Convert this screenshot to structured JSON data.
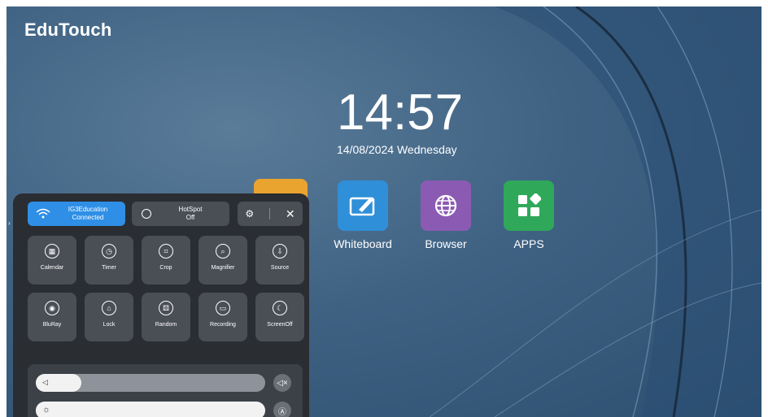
{
  "brand": "EduTouch",
  "clock": {
    "time": "14:57",
    "date": "14/08/2024  Wednesday"
  },
  "apps": [
    {
      "label": "Whiteboard",
      "color": "#2f8fd8",
      "icon": "whiteboard-icon"
    },
    {
      "label": "Browser",
      "color": "#8b5bb3",
      "icon": "globe-icon"
    },
    {
      "label": "APPS",
      "color": "#2fa85a",
      "icon": "apps-grid-icon"
    }
  ],
  "control_panel": {
    "wifi": {
      "name": "IG3Education",
      "status": "Connected",
      "color": "#2f8fe6"
    },
    "hotspot": {
      "name": "HotSpot",
      "status": "Off"
    },
    "tools": [
      {
        "label": "Calendar",
        "icon": "calendar-icon",
        "glyph": "▦"
      },
      {
        "label": "Timer",
        "icon": "timer-icon",
        "glyph": "◷"
      },
      {
        "label": "Crop",
        "icon": "crop-icon",
        "glyph": "⌗"
      },
      {
        "label": "Magnifier",
        "icon": "magnifier-icon",
        "glyph": "⌕"
      },
      {
        "label": "Source",
        "icon": "source-icon",
        "glyph": "⇩"
      },
      {
        "label": "BluRay",
        "icon": "eye-icon",
        "glyph": "◉"
      },
      {
        "label": "Lock",
        "icon": "lock-icon",
        "glyph": "⌂"
      },
      {
        "label": "Random",
        "icon": "dice-icon",
        "glyph": "⚄"
      },
      {
        "label": "Recording",
        "icon": "camera-icon",
        "glyph": "▭"
      },
      {
        "label": "ScreenOff",
        "icon": "moon-icon",
        "glyph": "☾"
      }
    ],
    "volume": {
      "level": 0.2,
      "icon": "speaker-icon",
      "mute_icon": "mute-icon"
    },
    "brightness": {
      "level": 1.0,
      "icon": "sun-icon",
      "auto_icon": "auto-brightness-icon"
    }
  }
}
